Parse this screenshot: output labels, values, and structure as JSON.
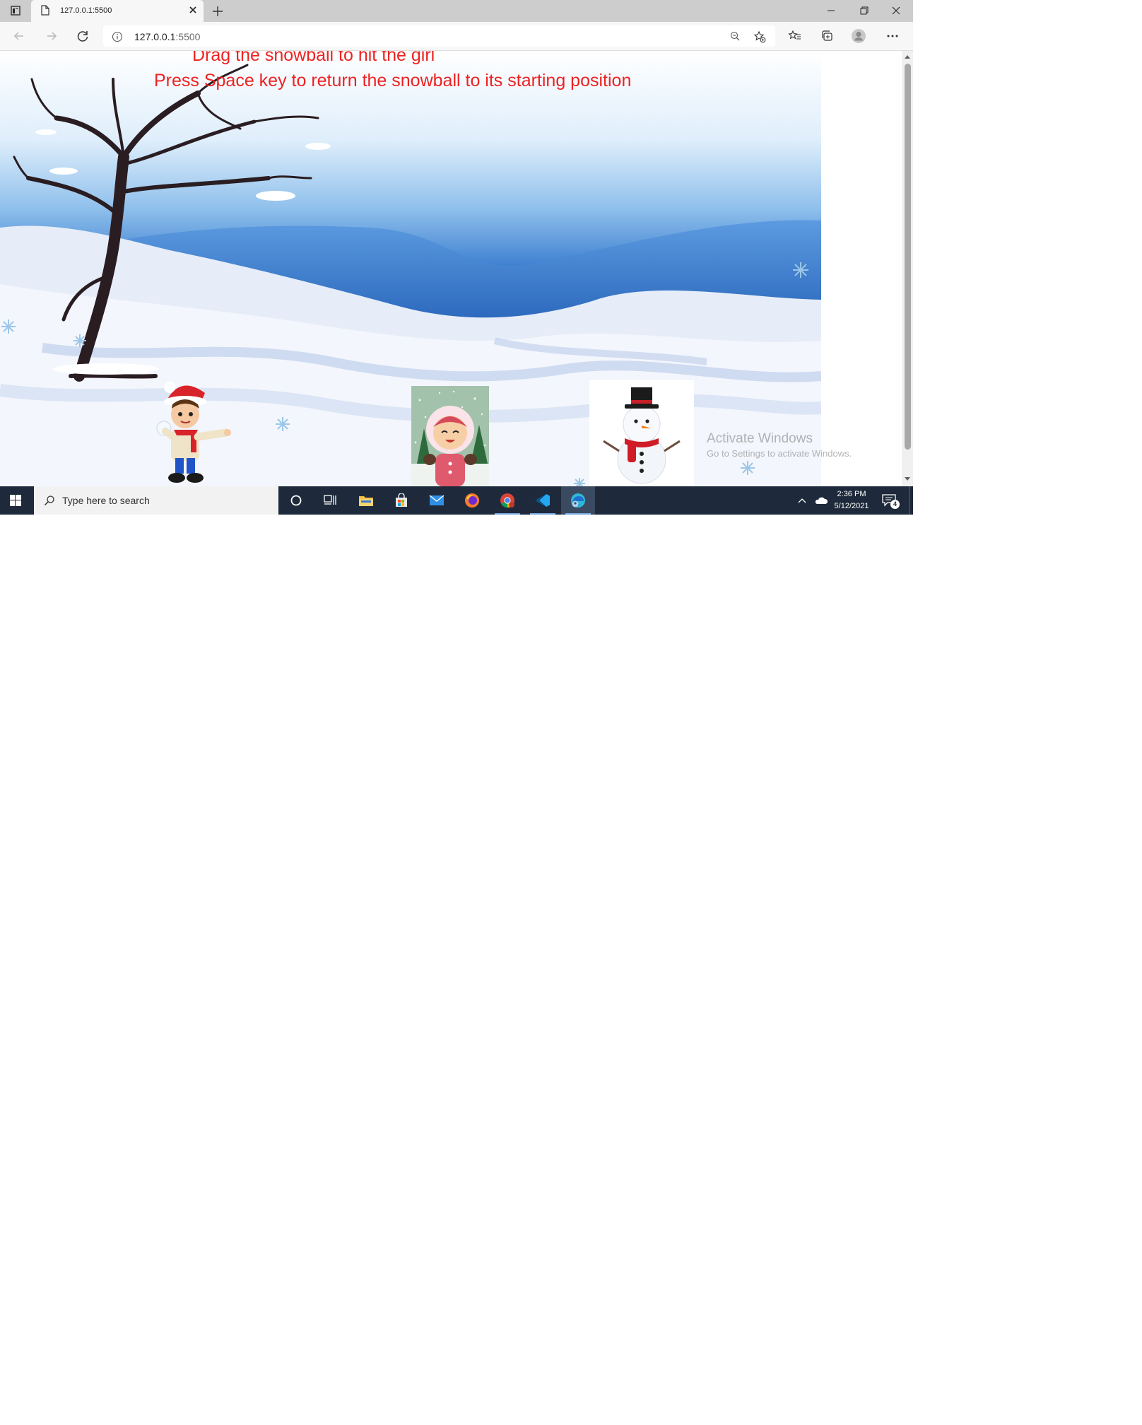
{
  "browser": {
    "tab_title": "127.0.0.1:5500",
    "url_host": "127.0.0.1",
    "url_port": ":5500"
  },
  "page": {
    "instruction_1": "Drag the snowball to hit the girl",
    "instruction_2": "Press Space key to return the snowball to its starting position"
  },
  "watermark": {
    "line1": "Activate Windows",
    "line2": "Go to Settings to activate Windows."
  },
  "taskbar": {
    "search_placeholder": "Type here to search",
    "time": "2:36 PM",
    "date": "5/12/2021",
    "notification_count": "4"
  },
  "colors": {
    "instruction_text": "#ee2222",
    "taskbar": "#1e2a3b"
  }
}
